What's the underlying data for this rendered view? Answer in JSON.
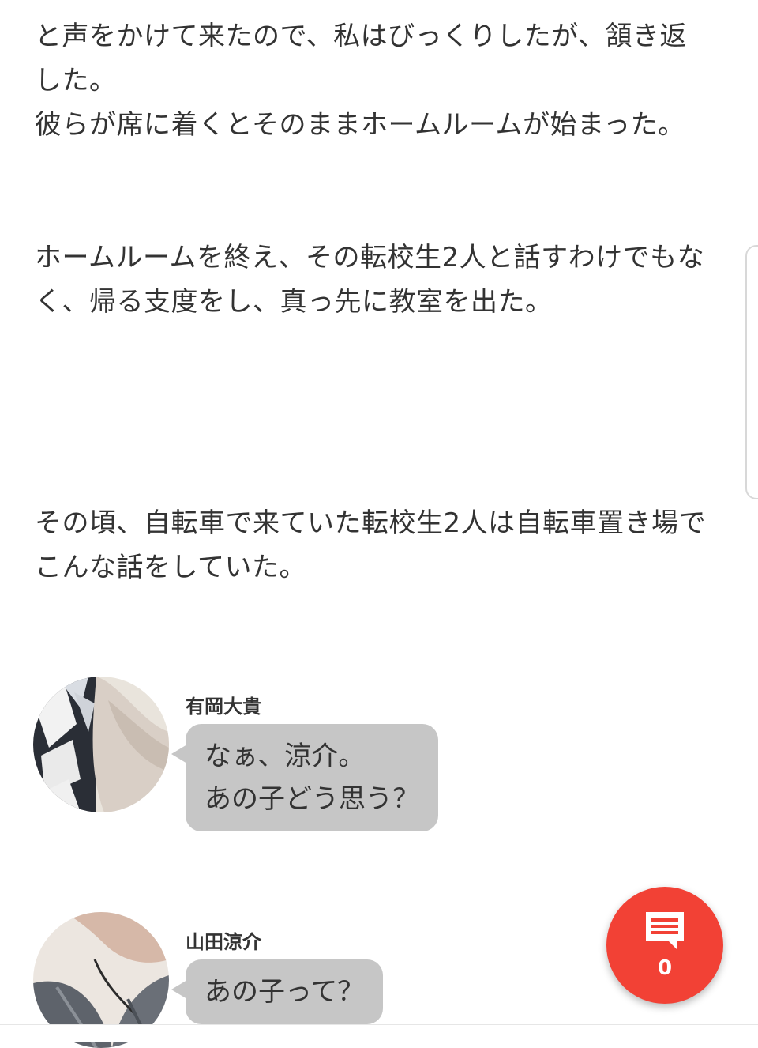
{
  "story": {
    "p1": [
      "と声をかけて来たので、私はびっくりしたが、頷き返",
      "した。",
      "彼らが席に着くとそのままホームルームが始まった。"
    ],
    "p2": [
      "ホームルームを終え、その転校生2人と話すわけでもな",
      "く、帰る支度をし、真っ先に教室を出た。"
    ],
    "p3": [
      "その頃、自転車で来ていた転校生2人は自転車置き場で",
      "こんな話をしていた。"
    ]
  },
  "chat": [
    {
      "speaker": "有岡大貴",
      "lines": [
        "なぁ、涼介。",
        "あの子どう思う？"
      ]
    },
    {
      "speaker": "山田涼介",
      "lines": [
        "あの子って？"
      ]
    }
  ],
  "comment_fab": {
    "icon": "comment-icon",
    "count": "0",
    "color": "#f24135"
  },
  "colors": {
    "bubble": "#c6c6c6",
    "text": "#333333"
  }
}
